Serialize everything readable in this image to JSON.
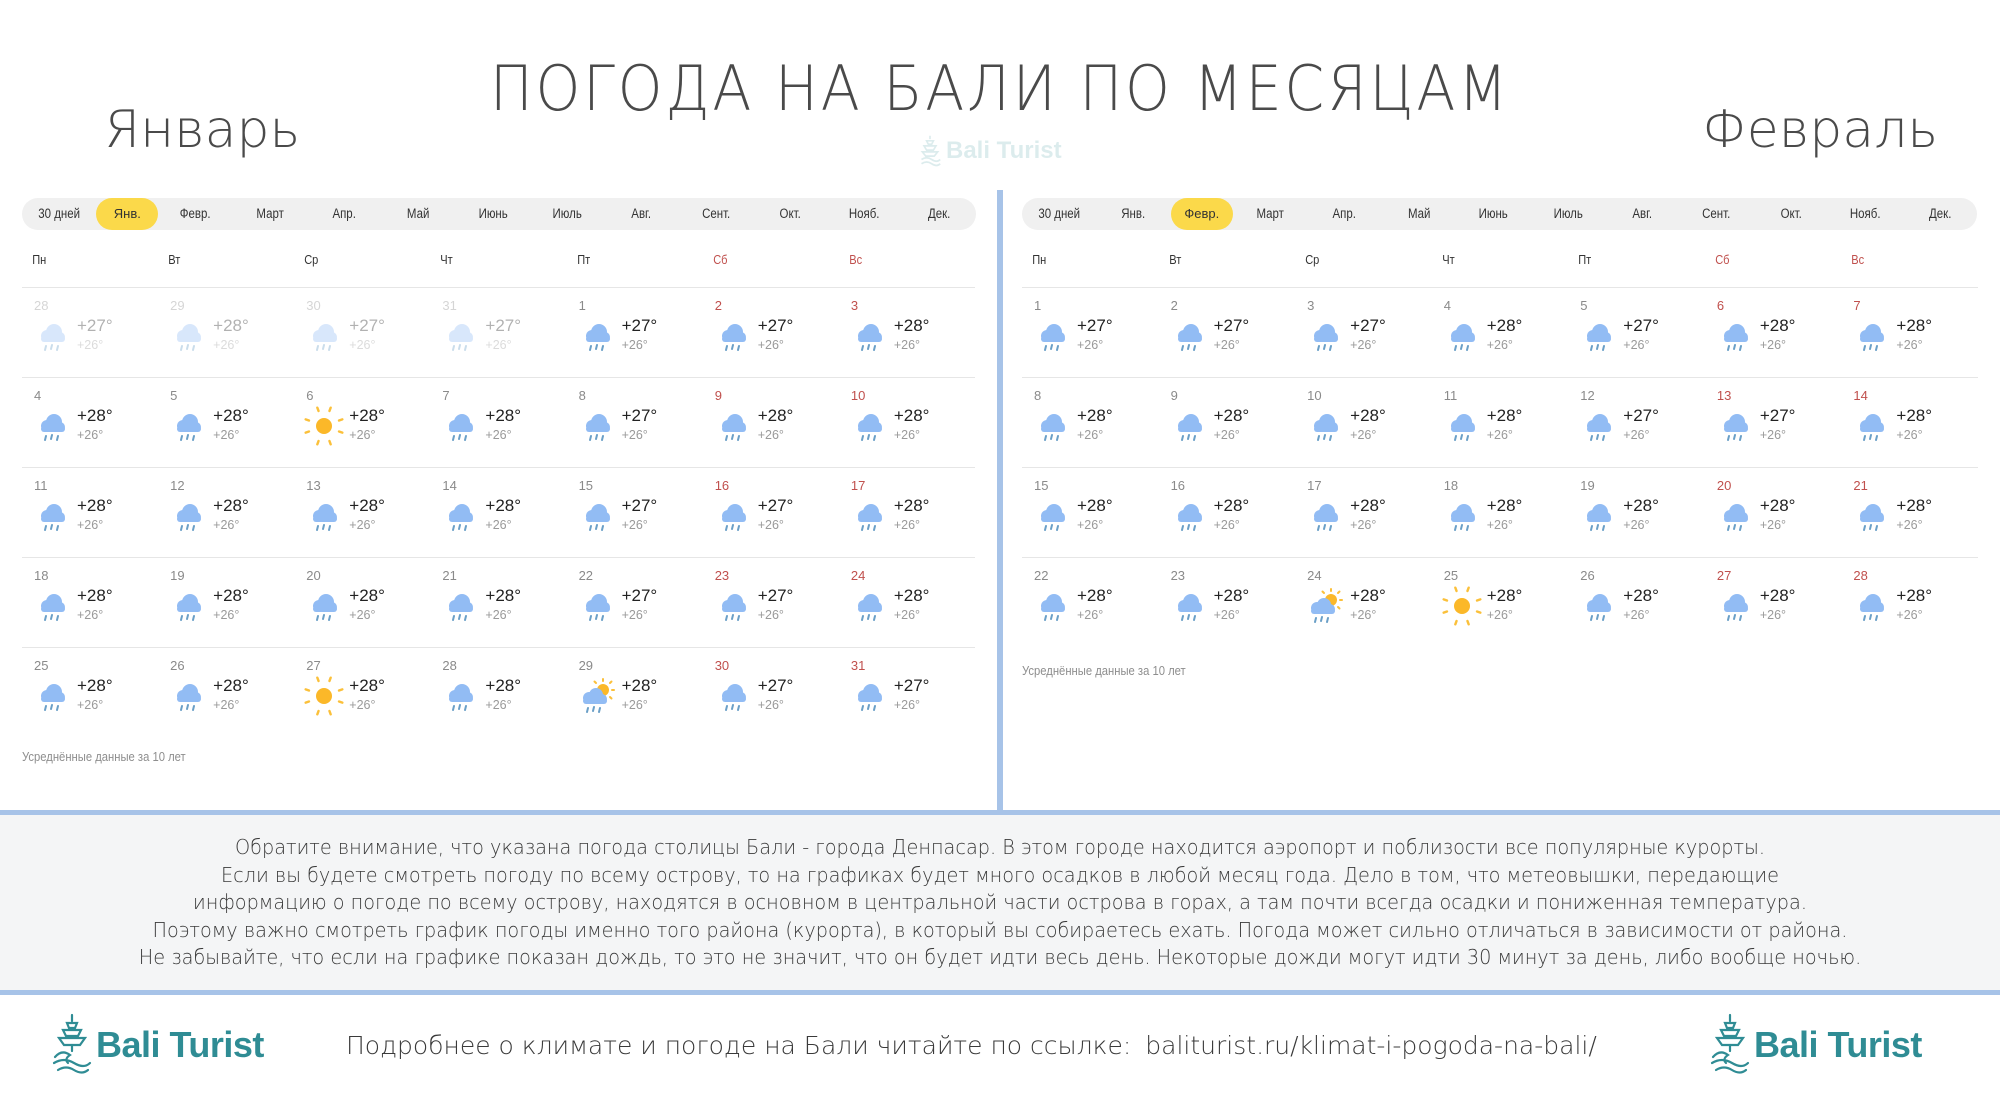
{
  "header": {
    "title": "ПОГОДА НА БАЛИ ПО МЕСЯЦАМ",
    "watermark": "Bali Turist"
  },
  "colors": {
    "accent_tab": "#fbd94a",
    "weekend": "#c0504d",
    "divider": "#a7c3e8",
    "brand": "#2f8c94"
  },
  "months_nav": [
    "30 дней",
    "Янв.",
    "Февр.",
    "Март",
    "Апр.",
    "Май",
    "Июнь",
    "Июль",
    "Авг.",
    "Сент.",
    "Окт.",
    "Нояб.",
    "Дек."
  ],
  "weekdays": [
    "Пн",
    "Вт",
    "Ср",
    "Чт",
    "Пт",
    "Сб",
    "Вс"
  ],
  "january": {
    "title": "Январь",
    "active_tab": "Янв.",
    "footnote": "Усреднённые данные за 10 лет",
    "weeks": [
      [
        {
          "day": "28",
          "hi": "+27°",
          "lo": "+26°",
          "icon": "rain",
          "outside": true
        },
        {
          "day": "29",
          "hi": "+28°",
          "lo": "+26°",
          "icon": "rain",
          "outside": true
        },
        {
          "day": "30",
          "hi": "+27°",
          "lo": "+26°",
          "icon": "rain",
          "outside": true
        },
        {
          "day": "31",
          "hi": "+27°",
          "lo": "+26°",
          "icon": "rain",
          "outside": true
        },
        {
          "day": "1",
          "hi": "+27°",
          "lo": "+26°",
          "icon": "rain"
        },
        {
          "day": "2",
          "hi": "+27°",
          "lo": "+26°",
          "icon": "rain"
        },
        {
          "day": "3",
          "hi": "+28°",
          "lo": "+26°",
          "icon": "rain"
        }
      ],
      [
        {
          "day": "4",
          "hi": "+28°",
          "lo": "+26°",
          "icon": "rain"
        },
        {
          "day": "5",
          "hi": "+28°",
          "lo": "+26°",
          "icon": "rain"
        },
        {
          "day": "6",
          "hi": "+28°",
          "lo": "+26°",
          "icon": "sun"
        },
        {
          "day": "7",
          "hi": "+28°",
          "lo": "+26°",
          "icon": "rain"
        },
        {
          "day": "8",
          "hi": "+27°",
          "lo": "+26°",
          "icon": "rain"
        },
        {
          "day": "9",
          "hi": "+28°",
          "lo": "+26°",
          "icon": "rain"
        },
        {
          "day": "10",
          "hi": "+28°",
          "lo": "+26°",
          "icon": "rain"
        }
      ],
      [
        {
          "day": "11",
          "hi": "+28°",
          "lo": "+26°",
          "icon": "rain"
        },
        {
          "day": "12",
          "hi": "+28°",
          "lo": "+26°",
          "icon": "rain"
        },
        {
          "day": "13",
          "hi": "+28°",
          "lo": "+26°",
          "icon": "rain"
        },
        {
          "day": "14",
          "hi": "+28°",
          "lo": "+26°",
          "icon": "rain"
        },
        {
          "day": "15",
          "hi": "+27°",
          "lo": "+26°",
          "icon": "rain"
        },
        {
          "day": "16",
          "hi": "+27°",
          "lo": "+26°",
          "icon": "rain"
        },
        {
          "day": "17",
          "hi": "+28°",
          "lo": "+26°",
          "icon": "rain"
        }
      ],
      [
        {
          "day": "18",
          "hi": "+28°",
          "lo": "+26°",
          "icon": "rain"
        },
        {
          "day": "19",
          "hi": "+28°",
          "lo": "+26°",
          "icon": "rain"
        },
        {
          "day": "20",
          "hi": "+28°",
          "lo": "+26°",
          "icon": "rain"
        },
        {
          "day": "21",
          "hi": "+28°",
          "lo": "+26°",
          "icon": "rain"
        },
        {
          "day": "22",
          "hi": "+27°",
          "lo": "+26°",
          "icon": "rain"
        },
        {
          "day": "23",
          "hi": "+27°",
          "lo": "+26°",
          "icon": "rain"
        },
        {
          "day": "24",
          "hi": "+28°",
          "lo": "+26°",
          "icon": "rain"
        }
      ],
      [
        {
          "day": "25",
          "hi": "+28°",
          "lo": "+26°",
          "icon": "rain"
        },
        {
          "day": "26",
          "hi": "+28°",
          "lo": "+26°",
          "icon": "rain"
        },
        {
          "day": "27",
          "hi": "+28°",
          "lo": "+26°",
          "icon": "sun"
        },
        {
          "day": "28",
          "hi": "+28°",
          "lo": "+26°",
          "icon": "rain"
        },
        {
          "day": "29",
          "hi": "+28°",
          "lo": "+26°",
          "icon": "sun-rain"
        },
        {
          "day": "30",
          "hi": "+27°",
          "lo": "+26°",
          "icon": "rain"
        },
        {
          "day": "31",
          "hi": "+27°",
          "lo": "+26°",
          "icon": "rain"
        }
      ]
    ]
  },
  "february": {
    "title": "Февраль",
    "active_tab": "Февр.",
    "footnote": "Усреднённые данные за 10 лет",
    "weeks": [
      [
        {
          "day": "1",
          "hi": "+27°",
          "lo": "+26°",
          "icon": "rain"
        },
        {
          "day": "2",
          "hi": "+27°",
          "lo": "+26°",
          "icon": "rain"
        },
        {
          "day": "3",
          "hi": "+27°",
          "lo": "+26°",
          "icon": "rain"
        },
        {
          "day": "4",
          "hi": "+28°",
          "lo": "+26°",
          "icon": "rain"
        },
        {
          "day": "5",
          "hi": "+27°",
          "lo": "+26°",
          "icon": "rain"
        },
        {
          "day": "6",
          "hi": "+28°",
          "lo": "+26°",
          "icon": "rain"
        },
        {
          "day": "7",
          "hi": "+28°",
          "lo": "+26°",
          "icon": "rain"
        }
      ],
      [
        {
          "day": "8",
          "hi": "+28°",
          "lo": "+26°",
          "icon": "rain"
        },
        {
          "day": "9",
          "hi": "+28°",
          "lo": "+26°",
          "icon": "rain"
        },
        {
          "day": "10",
          "hi": "+28°",
          "lo": "+26°",
          "icon": "rain"
        },
        {
          "day": "11",
          "hi": "+28°",
          "lo": "+26°",
          "icon": "rain"
        },
        {
          "day": "12",
          "hi": "+27°",
          "lo": "+26°",
          "icon": "rain"
        },
        {
          "day": "13",
          "hi": "+27°",
          "lo": "+26°",
          "icon": "rain"
        },
        {
          "day": "14",
          "hi": "+28°",
          "lo": "+26°",
          "icon": "rain"
        }
      ],
      [
        {
          "day": "15",
          "hi": "+28°",
          "lo": "+26°",
          "icon": "rain"
        },
        {
          "day": "16",
          "hi": "+28°",
          "lo": "+26°",
          "icon": "rain"
        },
        {
          "day": "17",
          "hi": "+28°",
          "lo": "+26°",
          "icon": "rain"
        },
        {
          "day": "18",
          "hi": "+28°",
          "lo": "+26°",
          "icon": "rain"
        },
        {
          "day": "19",
          "hi": "+28°",
          "lo": "+26°",
          "icon": "rain"
        },
        {
          "day": "20",
          "hi": "+28°",
          "lo": "+26°",
          "icon": "rain"
        },
        {
          "day": "21",
          "hi": "+28°",
          "lo": "+26°",
          "icon": "rain"
        }
      ],
      [
        {
          "day": "22",
          "hi": "+28°",
          "lo": "+26°",
          "icon": "rain"
        },
        {
          "day": "23",
          "hi": "+28°",
          "lo": "+26°",
          "icon": "rain"
        },
        {
          "day": "24",
          "hi": "+28°",
          "lo": "+26°",
          "icon": "sun-rain"
        },
        {
          "day": "25",
          "hi": "+28°",
          "lo": "+26°",
          "icon": "sun"
        },
        {
          "day": "26",
          "hi": "+28°",
          "lo": "+26°",
          "icon": "rain"
        },
        {
          "day": "27",
          "hi": "+28°",
          "lo": "+26°",
          "icon": "rain"
        },
        {
          "day": "28",
          "hi": "+28°",
          "lo": "+26°",
          "icon": "rain"
        }
      ]
    ]
  },
  "notes": [
    "Обратите внимание, что указана погода столицы Бали - города Денпасар. В этом городе находится аэропорт и поблизости все популярные курорты.",
    "Если вы будете смотреть погоду по всему острову, то на графиках будет много осадков в любой месяц года. Дело в том, что метеовышки, передающие",
    "информацию о погоде по всему острову, находятся в основном в центральной части острова в горах, а там почти всегда осадки и пониженная температура.",
    "Поэтому важно смотреть график погоды именно того района (курорта), в который вы собираетесь ехать. Погода может сильно отличаться в зависимости от района.",
    "Не забывайте, что если на графике показан дождь, то это не значит, что он будет идти весь день. Некоторые дожди могут идти 30 минут за день, либо вообще ночью."
  ],
  "footer": {
    "logo_text": "Bali Turist",
    "text": "Подробнее о климате и погоде на Бали читайте по ссылке:",
    "link": "baliturist.ru/klimat-i-pogoda-na-bali/"
  }
}
